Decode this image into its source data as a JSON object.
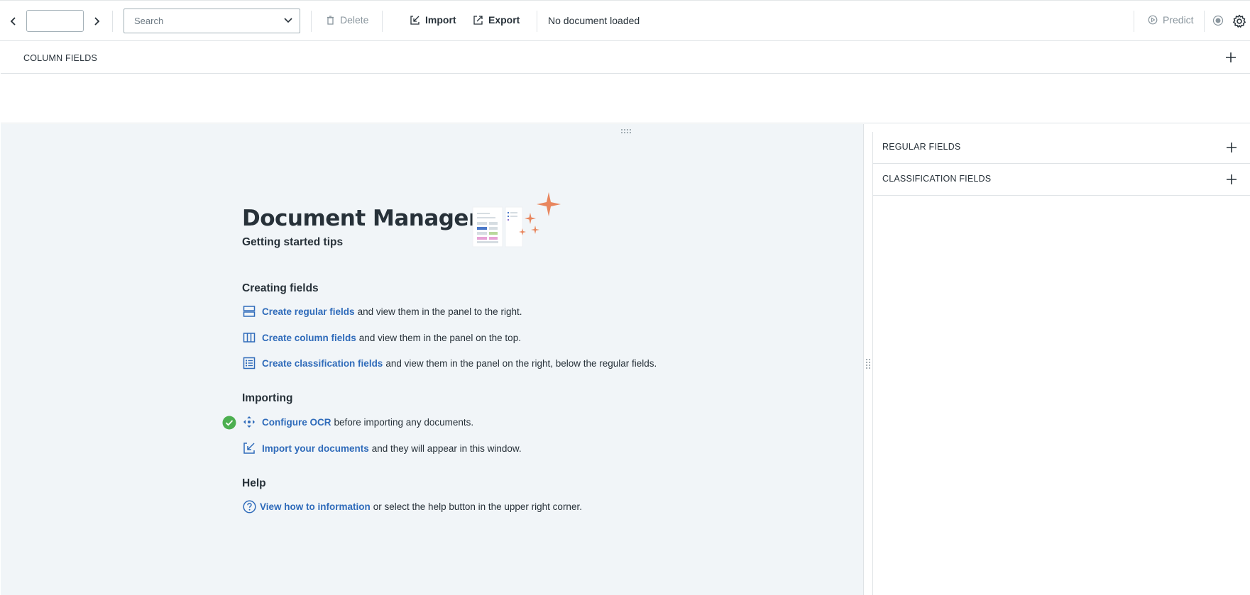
{
  "toolbar": {
    "page_value": "",
    "search_placeholder": "Search",
    "delete_label": "Delete",
    "import_label": "Import",
    "export_label": "Export",
    "status": "No document loaded",
    "predict_label": "Predict"
  },
  "column_fields": {
    "label": "COLUMN FIELDS"
  },
  "right_panel": {
    "regular_label": "REGULAR FIELDS",
    "classification_label": "CLASSIFICATION FIELDS"
  },
  "welcome": {
    "title": "Document Manager",
    "subtitle": "Getting started tips",
    "sections": {
      "creating": {
        "heading": "Creating fields",
        "tips": [
          {
            "icon": "regular-fields-icon",
            "link": "Create regular fields",
            "text": "and view them in the panel to the right."
          },
          {
            "icon": "column-fields-icon",
            "link": "Create column fields",
            "text": "and view them in the panel on the top."
          },
          {
            "icon": "classification-fields-icon",
            "link": "Create classification fields",
            "text": "and view them in the panel on the right, below the regular fields."
          }
        ]
      },
      "importing": {
        "heading": "Importing",
        "tips": [
          {
            "icon": "ocr-icon",
            "link": "Configure OCR",
            "text": "before importing any documents.",
            "done": true
          },
          {
            "icon": "import-icon",
            "link": "Import your documents",
            "text": "and they will appear in this window."
          }
        ]
      },
      "help": {
        "heading": "Help",
        "tips": [
          {
            "icon": "help-icon",
            "link": "View how to information",
            "text": "or select the help button in the upper right corner."
          }
        ]
      }
    }
  },
  "colors": {
    "link": "#2f6bba",
    "accent_orange": "#e8865e",
    "success_green": "#4caf50",
    "panel_bg": "#f1f5f8"
  }
}
